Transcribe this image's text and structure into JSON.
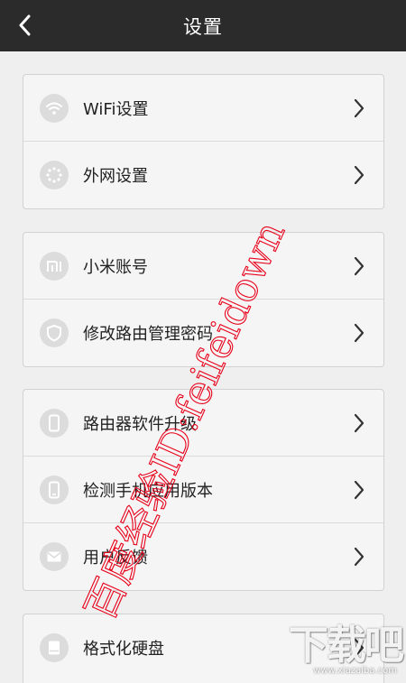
{
  "header": {
    "title": "设置",
    "back_icon": "chevron-left-icon"
  },
  "groups": [
    {
      "items": [
        {
          "label": "WiFi设置",
          "icon": "wifi-icon"
        },
        {
          "label": "外网设置",
          "icon": "network-dots-icon"
        }
      ]
    },
    {
      "items": [
        {
          "label": "小米账号",
          "icon": "mi-logo-icon"
        },
        {
          "label": "修改路由管理密码",
          "icon": "shield-icon"
        }
      ]
    },
    {
      "items": [
        {
          "label": "路由器软件升级",
          "icon": "device-icon"
        },
        {
          "label": "检测手机应用版本",
          "icon": "phone-icon"
        },
        {
          "label": "用户反馈",
          "icon": "mail-icon"
        }
      ]
    },
    {
      "items": [
        {
          "label": "格式化硬盘",
          "icon": "disk-icon"
        }
      ]
    }
  ],
  "watermark": {
    "text": "百度经验ID:feifeidown",
    "color": "#e8001a"
  },
  "site_logo": {
    "text": "下载吧",
    "url_text": "www.xiazaiba.com"
  },
  "colors": {
    "header_bg": "#2b2b2b",
    "page_bg": "#efefef",
    "row_bg": "#f5f5f5",
    "icon_bg": "#dcdcdc"
  }
}
